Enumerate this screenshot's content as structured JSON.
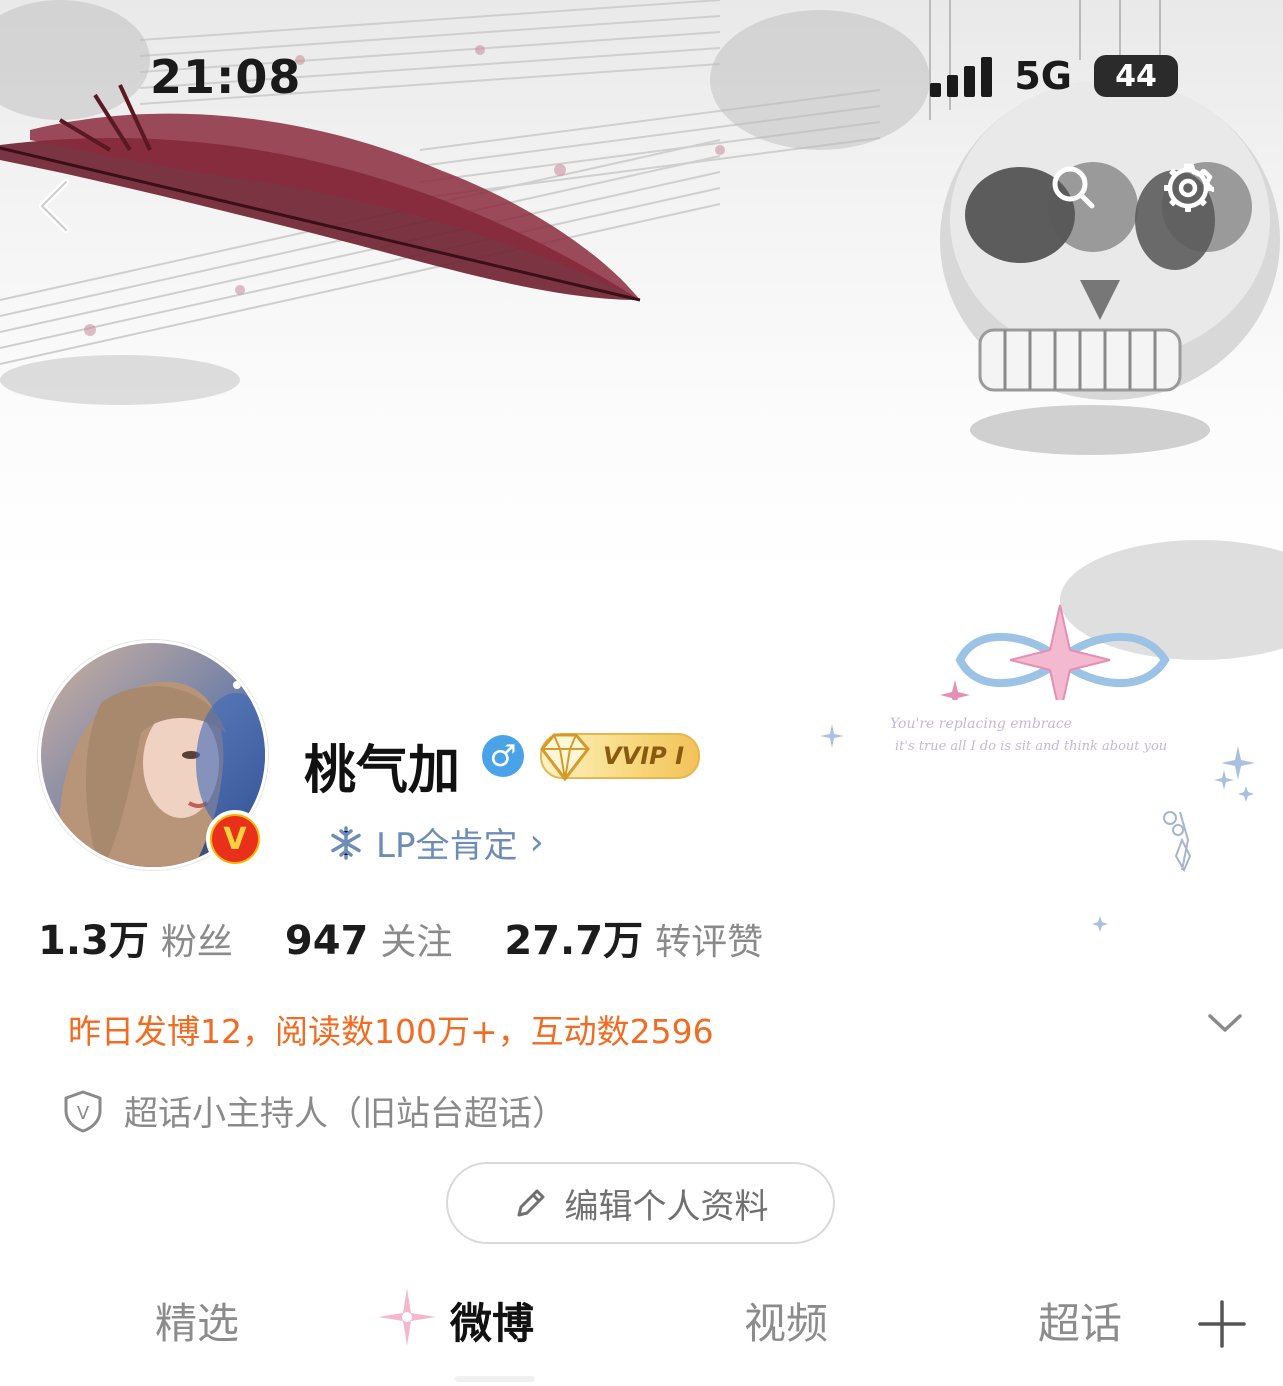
{
  "status_bar": {
    "time": "21:08",
    "network": "5G",
    "battery": "44"
  },
  "banner": {
    "script_line_1": "You're replacing embrace",
    "script_line_2": "it's true all I do is sit and think about you"
  },
  "profile": {
    "name": "桃气加",
    "gender_symbol": "♂",
    "vip_label": "VVIP Ⅰ",
    "verified_badge": "V",
    "tagline": "LP全肯定",
    "tagline_chevron": "›"
  },
  "stats": [
    {
      "value": "1.3万",
      "label": "粉丝"
    },
    {
      "value": "947",
      "label": "关注"
    },
    {
      "value": "27.7万",
      "label": "转评赞"
    }
  ],
  "activity_text": "昨日发博12，阅读数100万+，互动数2596",
  "host_text": "超话小主持人（旧站台超话）",
  "host_icon_letter": "V",
  "edit_button_label": "编辑个人资料",
  "tabs": [
    {
      "label": "精选"
    },
    {
      "label": "微博",
      "active": true
    },
    {
      "label": "视频"
    },
    {
      "label": "超话"
    }
  ],
  "icons": {
    "back": "back-arrow-icon",
    "search": "search-icon",
    "settings": "gear-icon",
    "edit": "pencil-icon",
    "expand": "chevron-down-icon",
    "add_tab": "plus-icon",
    "snowflake": "snowflake-icon"
  },
  "colors": {
    "accent_orange": "#f26b22",
    "link_blue": "#6d8db8",
    "gender_blue": "#4aa3e8",
    "feather": "#6e1f2e"
  }
}
